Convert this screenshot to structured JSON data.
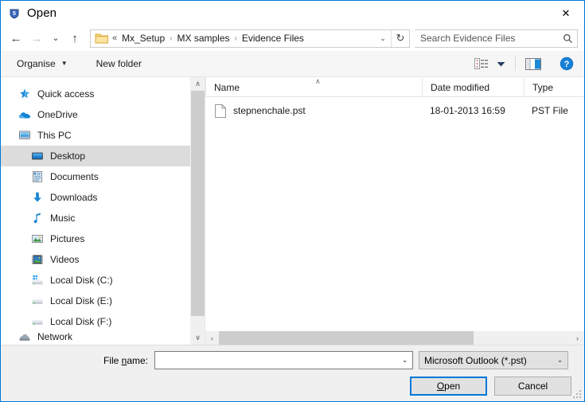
{
  "window": {
    "title": "Open",
    "app_icon": "shield-app-icon",
    "close_label": "✕",
    "accent_color": "#0078d7"
  },
  "nav": {
    "back": "←",
    "forward": "→",
    "recent_caret": "⌄",
    "up": "↑",
    "back_name": "back-button",
    "forward_name": "forward-button",
    "recent_name": "recent-locations-button",
    "up_name": "up-one-level-button"
  },
  "address": {
    "prefix": "«",
    "crumbs": [
      "Mx_Setup",
      "MX samples",
      "Evidence Files"
    ],
    "separator": "›",
    "dropdown_caret": "⌄",
    "refresh_glyph": "↻"
  },
  "search": {
    "placeholder": "Search Evidence Files",
    "value": ""
  },
  "toolbar": {
    "organise_label": "Organise",
    "organise_caret": "▼",
    "new_folder_label": "New folder",
    "view_caret": "▼",
    "view_icon": "list-view-icon",
    "preview_icon": "preview-pane-icon",
    "help_icon": "help-icon",
    "help_glyph": "?"
  },
  "sidebar": {
    "scroll_up": "∧",
    "scroll_down": "∨",
    "items": [
      {
        "label": "Quick access",
        "icon": "star-icon",
        "indent": false,
        "selected": false
      },
      {
        "label": "OneDrive",
        "icon": "cloud-icon",
        "indent": false,
        "selected": false
      },
      {
        "label": "This PC",
        "icon": "computer-icon",
        "indent": false,
        "selected": false
      },
      {
        "label": "Desktop",
        "icon": "desktop-icon",
        "indent": true,
        "selected": true
      },
      {
        "label": "Documents",
        "icon": "documents-icon",
        "indent": true,
        "selected": false
      },
      {
        "label": "Downloads",
        "icon": "downloads-icon",
        "indent": true,
        "selected": false
      },
      {
        "label": "Music",
        "icon": "music-icon",
        "indent": true,
        "selected": false
      },
      {
        "label": "Pictures",
        "icon": "pictures-icon",
        "indent": true,
        "selected": false
      },
      {
        "label": "Videos",
        "icon": "videos-icon",
        "indent": true,
        "selected": false
      },
      {
        "label": "Local Disk (C:)",
        "icon": "system-drive-icon",
        "indent": true,
        "selected": false
      },
      {
        "label": "Local Disk (E:)",
        "icon": "drive-icon",
        "indent": true,
        "selected": false
      },
      {
        "label": "Local Disk (F:)",
        "icon": "drive-icon",
        "indent": true,
        "selected": false
      },
      {
        "label": "Network",
        "icon": "network-icon",
        "indent": false,
        "selected": false
      }
    ]
  },
  "filelist": {
    "sort_caret": "∧",
    "columns": [
      "Name",
      "Date modified",
      "Type"
    ],
    "rows": [
      {
        "name": "stepnenchale.pst",
        "date": "18-01-2013 16:59",
        "type": "PST File",
        "icon": "file-icon"
      }
    ],
    "hscroll_left": "‹",
    "hscroll_right": "›"
  },
  "footer": {
    "file_name_label_pre": "File ",
    "file_name_label_accel": "n",
    "file_name_label_post": "ame:",
    "file_name_value": "",
    "file_name_placeholder": "",
    "file_name_caret": "⌄",
    "file_type_value": "Microsoft Outlook (*.pst)",
    "file_type_caret": "⌄",
    "open_pre": "",
    "open_accel": "O",
    "open_post": "pen",
    "cancel_label": "Cancel"
  }
}
